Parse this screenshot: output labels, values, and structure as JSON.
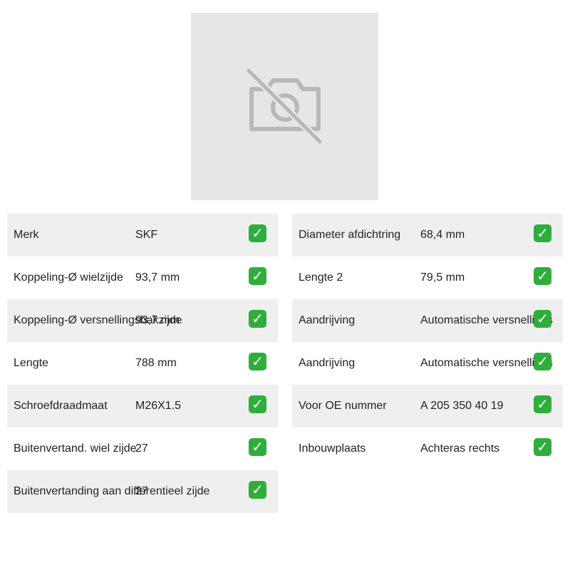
{
  "image": {
    "icon": "no-photo-camera-icon"
  },
  "specs_left": [
    {
      "label": "Merk",
      "value": "SKF"
    },
    {
      "label": "Koppeling-Ø wielzijde",
      "value": "93,7 mm"
    },
    {
      "label": "Koppeling-Ø versnellingsbakzijde",
      "value": "93,7 mm"
    },
    {
      "label": "Lengte",
      "value": "788 mm"
    },
    {
      "label": "Schroefdraadmaat",
      "value": "M26X1.5"
    },
    {
      "label": "Buitenvertand. wiel zijde",
      "value": "27"
    },
    {
      "label": "Buitenvertanding aan differentieel zijde",
      "value": "27"
    }
  ],
  "specs_right": [
    {
      "label": "Diameter afdichtring",
      "value": "68,4 mm"
    },
    {
      "label": "Lengte 2",
      "value": "79,5 mm"
    },
    {
      "label": "Aandrijving",
      "value": "Automatische versnellings"
    },
    {
      "label": "Aandrijving",
      "value": "Automatische versnellings"
    },
    {
      "label": "Voor OE nummer",
      "value": "A 205 350 40 19"
    },
    {
      "label": "Inbouwplaats",
      "value": "Achteras rechts"
    }
  ],
  "check_symbol": "✓",
  "colors": {
    "placeholder_bg": "#e6e6e6",
    "row_shade": "#efefef",
    "check_green": "#2eae3a"
  }
}
